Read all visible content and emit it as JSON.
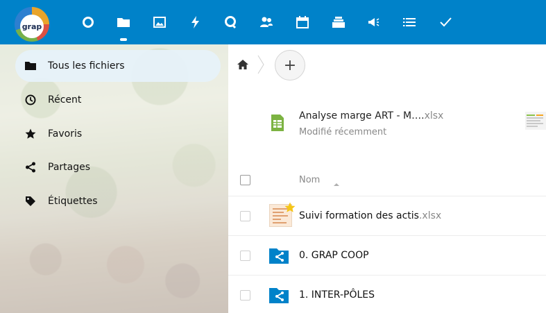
{
  "header": {
    "logo_text": "grap",
    "logo_colors": [
      "#f5a623",
      "#e94e3c",
      "#7cb342",
      "#2f7fd0"
    ],
    "accent": "#0082c9",
    "apps": [
      {
        "icon": "circle-icon"
      },
      {
        "icon": "folder-icon",
        "active": true
      },
      {
        "icon": "image-icon"
      },
      {
        "icon": "lightning-icon"
      },
      {
        "icon": "talk-bubble-icon"
      },
      {
        "icon": "contacts-icon"
      },
      {
        "icon": "calendar-icon"
      },
      {
        "icon": "deck-icon"
      },
      {
        "icon": "announcement-icon"
      },
      {
        "icon": "list-icon"
      },
      {
        "icon": "checkmark-icon"
      }
    ]
  },
  "sidebar": {
    "items": [
      {
        "label": "Tous les fichiers",
        "icon": "folder-icon",
        "active": true
      },
      {
        "label": "Récent",
        "icon": "clock-icon"
      },
      {
        "label": "Favoris",
        "icon": "star-icon"
      },
      {
        "label": "Partages",
        "icon": "share-icon"
      },
      {
        "label": "Étiquettes",
        "icon": "tag-icon"
      }
    ]
  },
  "breadcrumb": {
    "home_icon": "home-icon",
    "add_label": "+"
  },
  "recent": {
    "name": "Analyse marge ART - M….",
    "ext": "xlsx",
    "subtitle": "Modifié récemment",
    "icon": "spreadsheet-icon",
    "icon_color": "#7cb342"
  },
  "table": {
    "header": {
      "name": "Nom",
      "sort_icon": "sort-asc-icon"
    },
    "rows": [
      {
        "name": "Suivi formation des actis",
        "ext": ".xlsx",
        "type": "file",
        "favorite": true
      },
      {
        "name": "0. GRAP COOP",
        "ext": "",
        "type": "shared-folder"
      },
      {
        "name": "1. INTER-PÔLES",
        "ext": "",
        "type": "shared-folder"
      }
    ]
  }
}
